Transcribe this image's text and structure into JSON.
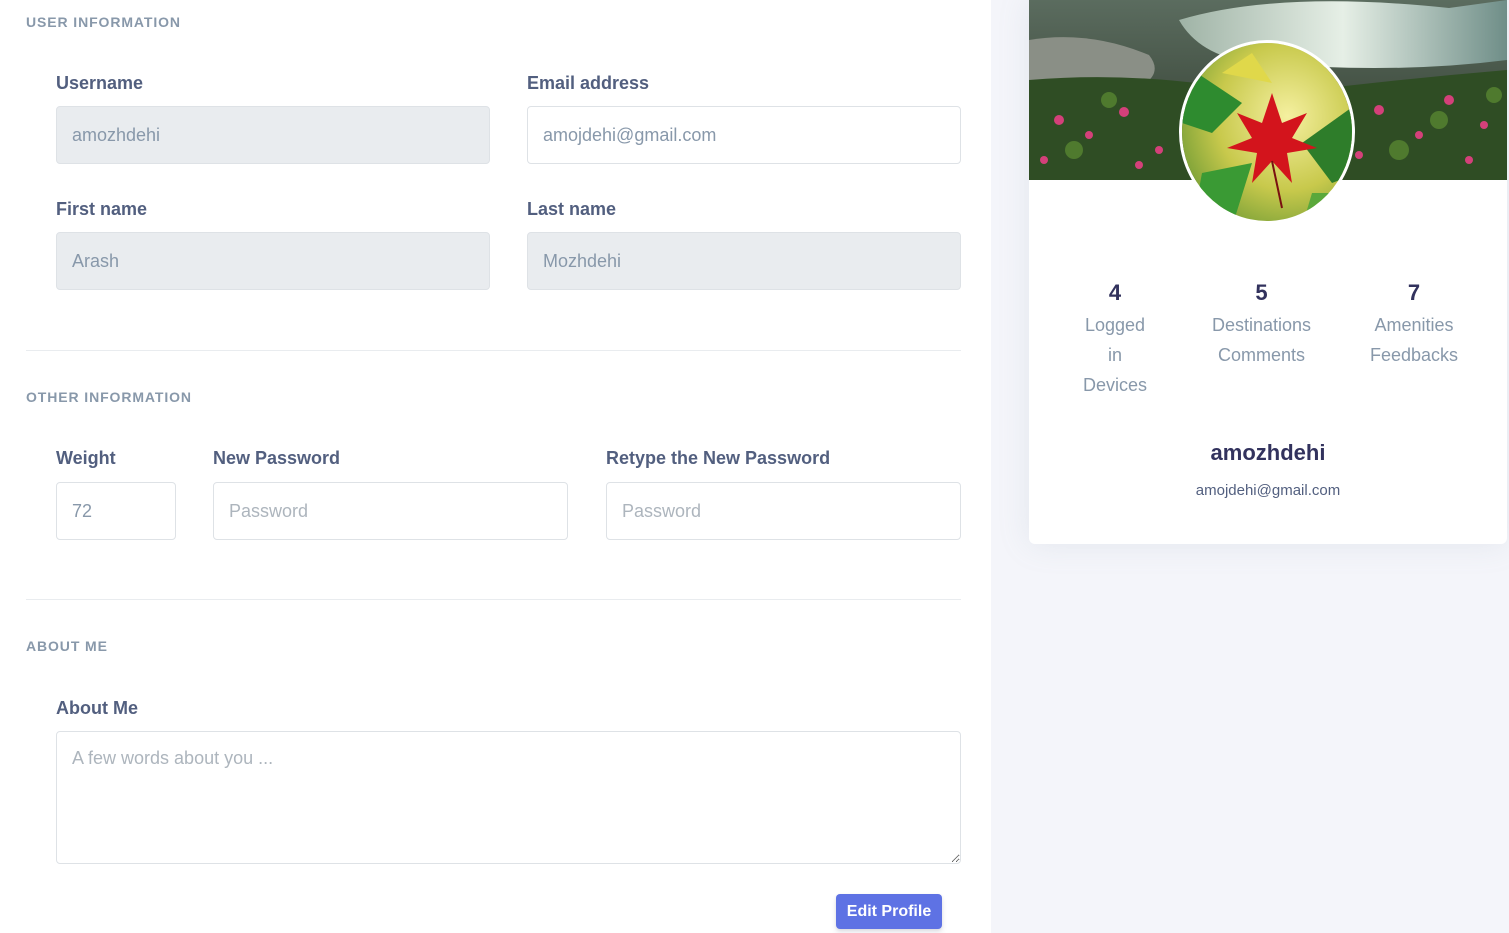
{
  "form": {
    "sections": {
      "user_information": "User information",
      "other_information": "Other information",
      "about_me": "About me"
    },
    "fields": {
      "username": {
        "label": "Username",
        "value": "amozhdehi"
      },
      "email": {
        "label": "Email address",
        "value": "amojdehi@gmail.com"
      },
      "first_name": {
        "label": "First name",
        "value": "Arash"
      },
      "last_name": {
        "label": "Last name",
        "value": "Mozhdehi"
      },
      "weight": {
        "label": "Weight",
        "value": "72"
      },
      "new_password": {
        "label": "New Password",
        "placeholder": "Password"
      },
      "retype_password": {
        "label": "Retype the New Password",
        "placeholder": "Password"
      },
      "about": {
        "label": "About Me",
        "placeholder": "A few words about you ..."
      }
    },
    "edit_button": "Edit Profile"
  },
  "profile": {
    "stats": [
      {
        "value": "4",
        "lines": [
          "Logged",
          "in",
          "Devices"
        ]
      },
      {
        "value": "5",
        "lines": [
          "Destinations",
          "Comments"
        ]
      },
      {
        "value": "7",
        "lines": [
          "Amenities",
          "Feedbacks"
        ]
      }
    ],
    "name": "amozhdehi",
    "email": "amojdehi@gmail.com"
  },
  "colors": {
    "accent": "#5e72e4",
    "muted": "#8898aa",
    "heading": "#32325d"
  }
}
